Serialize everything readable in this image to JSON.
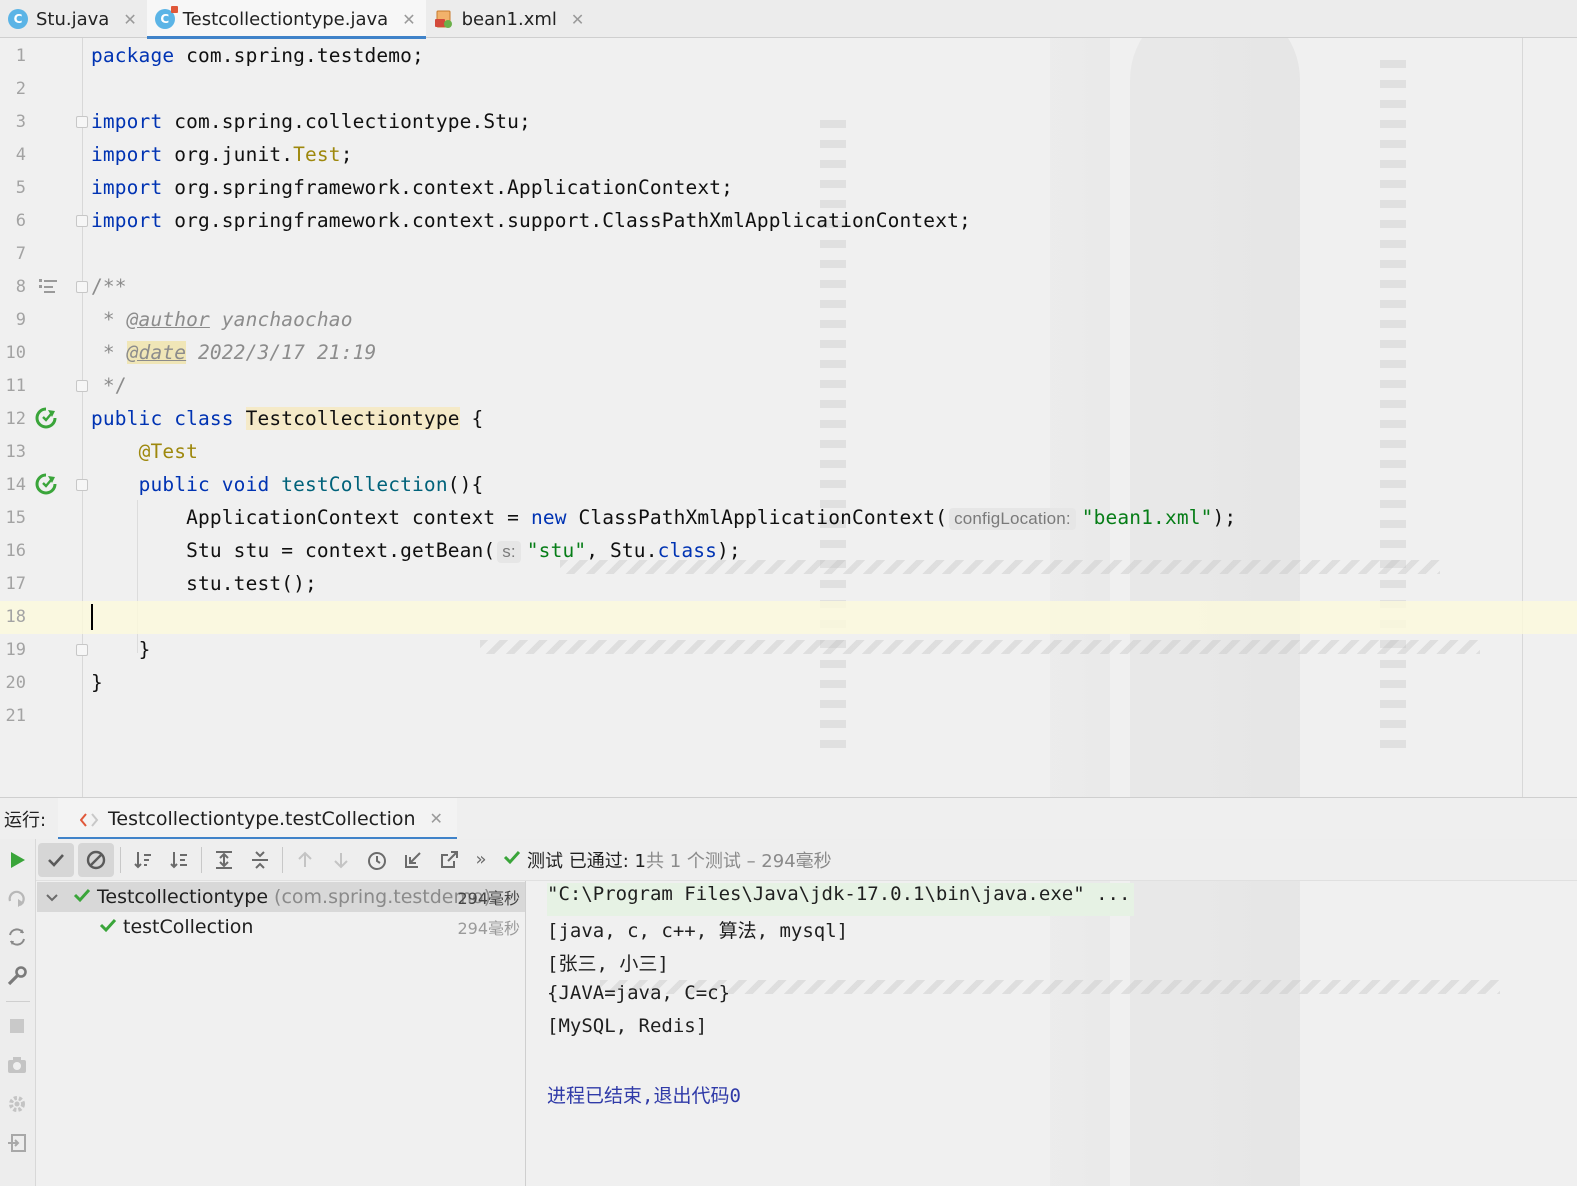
{
  "tabs": [
    {
      "label": "Stu.java",
      "icon": "java-class-icon",
      "active": false
    },
    {
      "label": "Testcollectiontype.java",
      "icon": "java-test-class-icon",
      "active": true
    },
    {
      "label": "bean1.xml",
      "icon": "xml-file-icon",
      "active": false
    }
  ],
  "editor": {
    "line_numbers": [
      "1",
      "2",
      "3",
      "4",
      "5",
      "6",
      "7",
      "8",
      "9",
      "10",
      "11",
      "12",
      "13",
      "14",
      "15",
      "16",
      "17",
      "18",
      "19",
      "20",
      "21"
    ],
    "current_line": "18",
    "code": {
      "l1_kw": "package",
      "l1_rest": " com.spring.testdemo;",
      "l3_kw": "import",
      "l3_rest": " com.spring.collectiontype.Stu;",
      "l4_kw": "import",
      "l4_rest": " org.junit.",
      "l4_ann": "Test",
      "l4_end": ";",
      "l5_kw": "import",
      "l5_rest": " org.springframework.context.ApplicationContext;",
      "l6_kw": "import",
      "l6_rest": " org.springframework.context.support.ClassPathXmlApplicationContext;",
      "l8": "/**",
      "l9_star": " * ",
      "l9_tag": "@author",
      "l9_val": " yanchaochao",
      "l10_star": " * ",
      "l10_tag": "@date",
      "l10_val": " 2022/3/17 21:19",
      "l11": " */",
      "l12_kw": "public class",
      "l12_cls": "Testcollectiontype",
      "l12_end": " {",
      "l13_ann": "@Test",
      "l14_kw": "public void",
      "l14_method": "testCollection",
      "l14_end": "(){",
      "l15_a": "ApplicationContext context = ",
      "l15_kw": "new",
      "l15_b": " ClassPathXmlApplicationContext(",
      "l15_hint": "configLocation:",
      "l15_str": "\"bean1.xml\"",
      "l15_end": ");",
      "l16_a": "Stu stu = context.getBean(",
      "l16_hint": "s:",
      "l16_str": "\"stu\"",
      "l16_b": ", Stu.",
      "l16_kw": "class",
      "l16_end": ");",
      "l17": "stu.test();",
      "l19": "}",
      "l20": "}"
    }
  },
  "run_panel": {
    "label": "运行:",
    "tab_label": "Testcollectiontype.testCollection",
    "status_main": "测试 已通过: 1",
    "status_sub": "共 1 个测试 – 294毫秒",
    "more_label": "»",
    "tree": [
      {
        "name": "Testcollectiontype",
        "package": "(com.spring.testdemo)",
        "time": "294毫秒"
      },
      {
        "name": "testCollection",
        "time": "294毫秒"
      }
    ],
    "console": [
      "\"C:\\Program Files\\Java\\jdk-17.0.1\\bin\\java.exe\" ...",
      "[java, c, c++, 算法, mysql]",
      "[张三, 小三]",
      "{JAVA=java, C=c}",
      "[MySQL, Redis]",
      "",
      "进程已结束,退出代码0"
    ]
  },
  "colors": {
    "keyword": "#0033b3",
    "annotation": "#9e880d",
    "string": "#067d17",
    "method": "#00627a",
    "comment": "#8c8c8c",
    "pass_green": "#3aa53a",
    "accent": "#4083c9"
  }
}
